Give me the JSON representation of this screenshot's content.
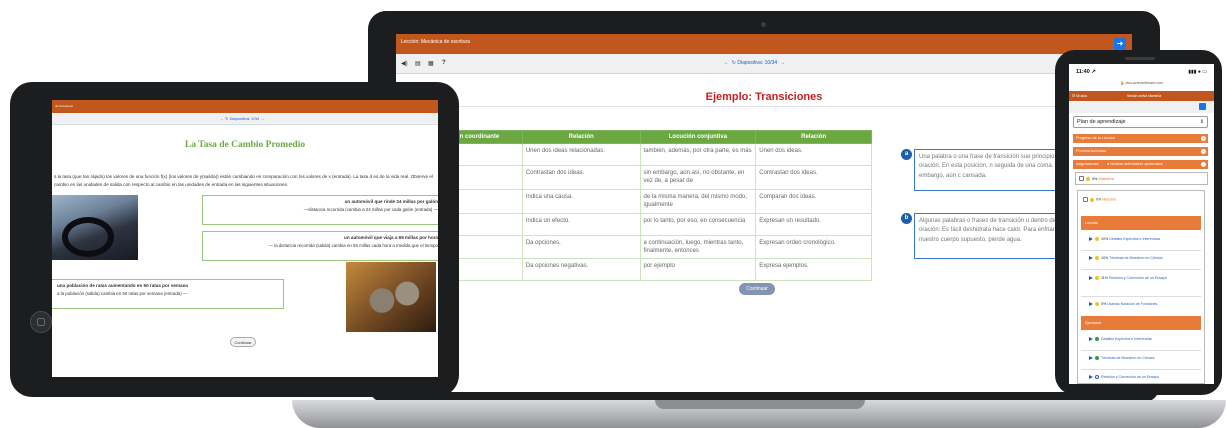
{
  "laptop": {
    "title": "Lección: Mecánica de escritura",
    "toolbar_icons": [
      "◀)",
      "▤",
      "▦",
      "?"
    ],
    "nav": {
      "prev": "←",
      "label": "↻ Diapositiva: 10/34",
      "next": "→"
    },
    "heading": "Ejemplo: Transiciones",
    "table": {
      "headers": [
        "n coordinante",
        "Relación",
        "Locución conjuntiva",
        "Relación"
      ],
      "rows": [
        [
          "",
          "Unen dos ideas relacionadas.",
          "también, además, por otra parte, es más",
          "Unen dos ideas."
        ],
        [
          "",
          "Contrastan dos ideas.",
          "sin embargo, aún así, no obstante, en vez de, a pesar de",
          "Contrastan dos ideas."
        ],
        [
          "",
          "Indica una causa.",
          "de la misma manera, del mismo modo, igualmente",
          "Comparan dos ideas."
        ],
        [
          "",
          "Indica un efecto.",
          "por lo tanto, por eso, en consecuencia",
          "Expresan un resultado."
        ],
        [
          "",
          "Da opciones.",
          "a continuación, luego, mientras tanto, finalmente, entonces",
          "Expresan orden cronológico."
        ],
        [
          "",
          "Da opciones negativas.",
          "por ejemplo",
          "Expresa ejemplos."
        ]
      ]
    },
    "continue": "Continuar",
    "note_a": {
      "badge": "a",
      "text": "Una palabra o una frase de transición sue principio de la oración. En esta posición, n seguida de una coma. Sin embargo, aún c cansada."
    },
    "note_b": {
      "badge": "b",
      "text": "Algunas palabras o frases de transición u dentro de una oración: Es fácil deshidrata hace calor. Para enfriarse, nuestro cuerpo supuesto, pierde agua."
    }
  },
  "tablet": {
    "title": "de Funciones",
    "nav": "←  ↻ Diapositiva: 2/34  →",
    "heading": "La Tasa de Cambio Promedio",
    "intro": "s la tasa (que tan rápido) los valores de una función f(x) (los valores de y(salida)) están cambiando en comparación con los valores de x (entrada). La tasa d es de la vida real. Observe el cambio en las unidades de salida con respecto al cambio en las unidades de entrada en las siguientes situaciones.",
    "card1_title": "un automóvil que rinde 24 millas por galón",
    "card1_text": "—distancia recorrida (cambia a 24 millas por cada galón (entrada) —",
    "card2_title": "un automóvil que viaja a 65 millas por hora",
    "card2_text": "— la distancia recorrida (salida) cambia en 65 millas cada hora a medida que el tiempo",
    "card3_title": "una población de ratas aumentando en 50 ratas por semana",
    "card3_text": "a la población (salida) cambia en 50 ratas por semana (entrada) —",
    "continue": "Continuar"
  },
  "phone": {
    "time": "11:40 ↗",
    "signal": "▮▮▮ ● ▭",
    "url": "🔒 plus.aztecsoftware.com",
    "bar_left": "☰  Mi aula",
    "bar_center": "Sesión activa   Maestría",
    "plan_label": "Plan de aprendizaje",
    "rows": [
      "Progreso de la Lección",
      "Próxima Actividad",
      "Asignaciones"
    ],
    "optional": "● Mostrar actividades opcionales",
    "mastery_pct": "0%",
    "mastery_label": "Maestría",
    "sections": {
      "lesson": "Lección",
      "exercises": "Ejercicios"
    },
    "lesson_items": [
      {
        "pct": "10%",
        "label": "Detalles Explícitos e Inferencias"
      },
      {
        "pct": "10%",
        "label": "Técnicas de Muestreo en Ciencia"
      },
      {
        "pct": "11%",
        "label": "Revisión y Corrección de un Ensayo"
      },
      {
        "pct": "0%",
        "label": "Usando Notación de Funciones"
      }
    ],
    "exercise_items": [
      {
        "label": "Detalles Explícitos e Inferencias"
      },
      {
        "label": "Técnicas de Muestreo en Ciencia"
      },
      {
        "label": "Revisión y Corrección de un Ensayo"
      }
    ]
  }
}
